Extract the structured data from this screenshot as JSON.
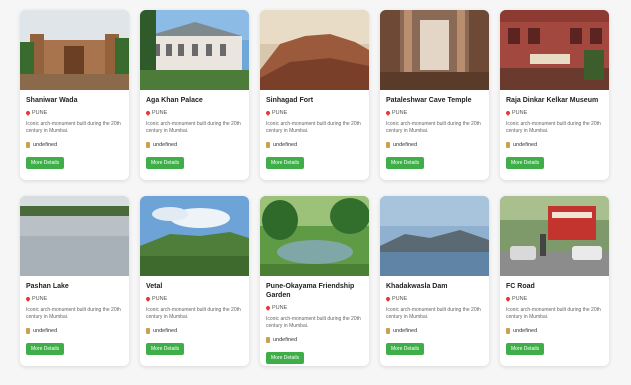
{
  "cards": [
    {
      "name": "Shaniwar Wada",
      "location": "PUNE",
      "description": "Iconic arch-monument built during the 20th century in Mumbai.",
      "budget": "undefined",
      "button": "More Details",
      "image": "fort-gate"
    },
    {
      "name": "Aga Khan Palace",
      "location": "PUNE",
      "description": "Iconic arch-monument built during the 20th century in Mumbai.",
      "budget": "undefined",
      "button": "More Details",
      "image": "palace"
    },
    {
      "name": "Sinhagad Fort",
      "location": "PUNE",
      "description": "Iconic arch-monument built during the 20th century in Mumbai.",
      "budget": "undefined",
      "button": "More Details",
      "image": "hill-fort"
    },
    {
      "name": "Pataleshwar Cave Temple",
      "location": "PUNE",
      "description": "Iconic arch-monument built during the 20th century in Mumbai.",
      "budget": "undefined",
      "button": "More Details",
      "image": "cave-temple"
    },
    {
      "name": "Raja Dinkar Kelkar Museum",
      "location": "PUNE",
      "description": "Iconic arch-monument built during the 20th century in Mumbai.",
      "budget": "undefined",
      "button": "More Details",
      "image": "museum"
    },
    {
      "name": "Pashan Lake",
      "location": "PUNE",
      "description": "Iconic arch-monument built during the 20th century in Mumbai.",
      "budget": "undefined",
      "button": "More Details",
      "image": "lake"
    },
    {
      "name": "Vetal",
      "location": "PUNE",
      "description": "Iconic arch-monument built during the 20th century in Mumbai.",
      "budget": "undefined",
      "button": "More Details",
      "image": "green-hill"
    },
    {
      "name": "Pune-Okayama Friendship Garden",
      "location": "PUNE",
      "description": "Iconic arch-monument built during the 20th century in Mumbai.",
      "budget": "undefined",
      "button": "More Details",
      "image": "garden"
    },
    {
      "name": "Khadakwasla Dam",
      "location": "PUNE",
      "description": "Iconic arch-monument built during the 20th century in Mumbai.",
      "budget": "undefined",
      "button": "More Details",
      "image": "dam"
    },
    {
      "name": "FC Road",
      "location": "PUNE",
      "description": "Iconic arch-monument built during the 20th century in Mumbai.",
      "budget": "undefined",
      "button": "More Details",
      "image": "street"
    }
  ],
  "colors": {
    "button": "#3fae49",
    "pin": "#e53935"
  }
}
